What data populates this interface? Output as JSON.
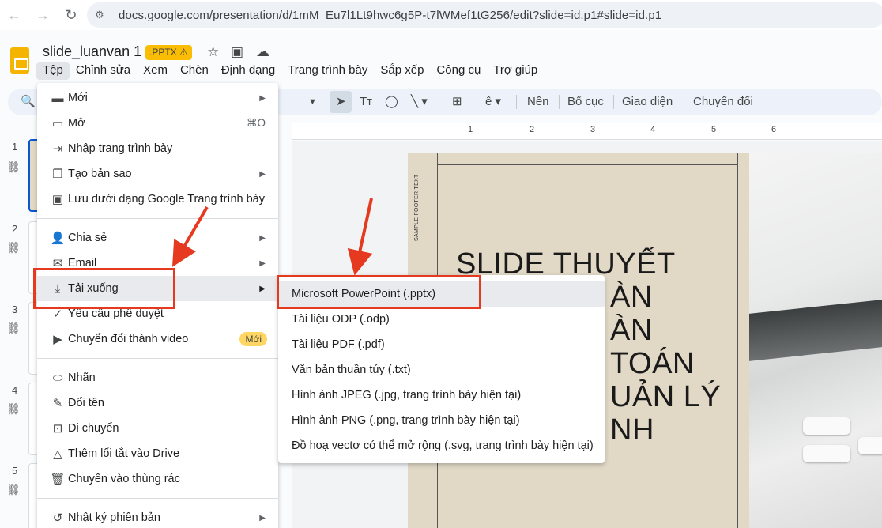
{
  "browser": {
    "url": "docs.google.com/presentation/d/1mM_Eu7l1Lt9hwc6g5P-t7lWMef1tG256/edit?slide=id.p1#slide=id.p1"
  },
  "doc": {
    "title": "slide_luanvan 1",
    "badge": ".PPTX"
  },
  "menubar": [
    "Tệp",
    "Chỉnh sửa",
    "Xem",
    "Chèn",
    "Định dạng",
    "Trang trình bày",
    "Sắp xếp",
    "Công cụ",
    "Trợ giúp"
  ],
  "toolbar": {
    "new_slide": "Nền",
    "layout": "Bố cục",
    "theme": "Giao diện",
    "transition": "Chuyển đổi"
  },
  "thumbnails": [
    "1",
    "2",
    "3",
    "4",
    "5"
  ],
  "ruler": [
    "1",
    "2",
    "3",
    "4",
    "5",
    "6"
  ],
  "file_menu": {
    "new": "Mới",
    "open": "Mở",
    "open_shortcut": "⌘O",
    "import": "Nhập trang trình bày",
    "copy": "Tạo bản sao",
    "save_as": "Lưu dưới dạng Google Trang trình bày",
    "share": "Chia sẻ",
    "email": "Email",
    "download": "Tải xuống",
    "approval": "Yêu cầu phê duyệt",
    "video": "Chuyển đổi thành video",
    "video_badge": "Mới",
    "labels": "Nhãn",
    "rename": "Đổi tên",
    "move": "Di chuyển",
    "shortcut": "Thêm lối tắt vào Drive",
    "trash": "Chuyển vào thùng rác",
    "history": "Nhật ký phiên bản"
  },
  "download_menu": [
    "Microsoft PowerPoint (.pptx)",
    "Tài liệu ODP (.odp)",
    "Tài liệu PDF (.pdf)",
    "Văn bản thuần túy (.txt)",
    "Hình ảnh JPEG (.jpg, trang trình bày hiện tại)",
    "Hình ảnh PNG (.png, trang trình bày hiện tại)",
    "Đồ hoạ vectơ có thể mở rộng (.svg, trang trình bày hiện tại)"
  ],
  "slide": {
    "footer": "SAMPLE FOOTER TEXT",
    "title_lines": [
      "SLIDE THUYẾT",
      "ÀN",
      "ÀN",
      "TOÁN",
      "UẢN LÝ",
      "NH"
    ]
  },
  "colors": {
    "highlight": "#e53a1f",
    "badge": "#fbbc04",
    "slide_bg": "#e1d8c6"
  }
}
